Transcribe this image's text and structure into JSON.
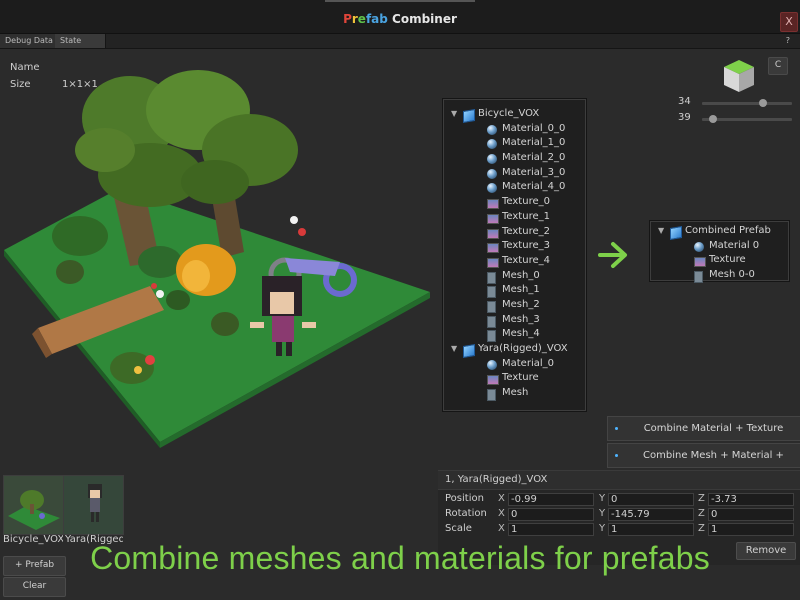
{
  "window": {
    "title_parts": [
      "P",
      "r",
      "e",
      "fab",
      " Combiner"
    ],
    "close_label": "X"
  },
  "tabs": [
    {
      "label": "Debug Data"
    },
    {
      "label": "State"
    }
  ],
  "help_label": "?",
  "info": {
    "name_label": "Name",
    "size_label": "Size",
    "size_value": "1×1×1"
  },
  "viewport": {
    "colors": {
      "ground": "#2f8a38",
      "tree_leaves": "#4e7a2a",
      "trunk": "#6a5436",
      "log": "#b07846",
      "pumpkin": "#e39a1c",
      "bicycle": "#6b6ad0"
    }
  },
  "view_controls": {
    "c_button_label": "C",
    "sliders": [
      {
        "value": "34",
        "fraction": 0.68
      },
      {
        "value": "39",
        "fraction": 0.12
      }
    ]
  },
  "tree": [
    {
      "type": "prefab",
      "label": "Bicycle_VOX",
      "depth": 0,
      "expanded": true
    },
    {
      "type": "material",
      "label": "Material_0_0",
      "depth": 1
    },
    {
      "type": "material",
      "label": "Material_1_0",
      "depth": 1
    },
    {
      "type": "material",
      "label": "Material_2_0",
      "depth": 1
    },
    {
      "type": "material",
      "label": "Material_3_0",
      "depth": 1
    },
    {
      "type": "material",
      "label": "Material_4_0",
      "depth": 1
    },
    {
      "type": "texture",
      "label": "Texture_0",
      "depth": 1
    },
    {
      "type": "texture",
      "label": "Texture_1",
      "depth": 1
    },
    {
      "type": "texture",
      "label": "Texture_2",
      "depth": 1
    },
    {
      "type": "texture",
      "label": "Texture_3",
      "depth": 1
    },
    {
      "type": "texture",
      "label": "Texture_4",
      "depth": 1
    },
    {
      "type": "mesh",
      "label": "Mesh_0",
      "depth": 1
    },
    {
      "type": "mesh",
      "label": "Mesh_1",
      "depth": 1
    },
    {
      "type": "mesh",
      "label": "Mesh_2",
      "depth": 1
    },
    {
      "type": "mesh",
      "label": "Mesh_3",
      "depth": 1
    },
    {
      "type": "mesh",
      "label": "Mesh_4",
      "depth": 1
    },
    {
      "type": "prefab",
      "label": "Yara(Rigged)_VOX",
      "depth": 0,
      "expanded": true
    },
    {
      "type": "material",
      "label": "Material_0",
      "depth": 1
    },
    {
      "type": "texture",
      "label": "Texture",
      "depth": 1
    },
    {
      "type": "mesh",
      "label": "Mesh",
      "depth": 1
    }
  ],
  "combined_tree": [
    {
      "type": "prefab",
      "label": "Combined Prefab",
      "depth": 0,
      "expanded": true
    },
    {
      "type": "material",
      "label": "Material 0",
      "depth": 1
    },
    {
      "type": "texture",
      "label": "Texture",
      "depth": 1
    },
    {
      "type": "mesh",
      "label": "Mesh 0-0",
      "depth": 1
    }
  ],
  "arrow_color": "#7ed04a",
  "actions": {
    "combine_material_texture": "Combine Material + Texture",
    "combine_mesh_material_texture": "Combine Mesh + Material + Texture"
  },
  "transform": {
    "title": "1, Yara(Rigged)_VOX",
    "rows": [
      {
        "label": "Position",
        "x": "-0.99",
        "y": "0",
        "z": "-3.73"
      },
      {
        "label": "Rotation",
        "x": "0",
        "y": "-145.79",
        "z": "0"
      },
      {
        "label": "Scale",
        "x": "1",
        "y": "1",
        "z": "1"
      }
    ],
    "axes": [
      "X",
      "Y",
      "Z"
    ],
    "remove_label": "Remove"
  },
  "thumbnails": [
    {
      "label": "Bicycle_VOX"
    },
    {
      "label": "Yara(Rigged"
    }
  ],
  "side_buttons": {
    "add_prefab": "+ Prefab",
    "clear": "Clear"
  },
  "caption": "Combine meshes and materials for prefabs",
  "accent_color": "#4fb4ff"
}
